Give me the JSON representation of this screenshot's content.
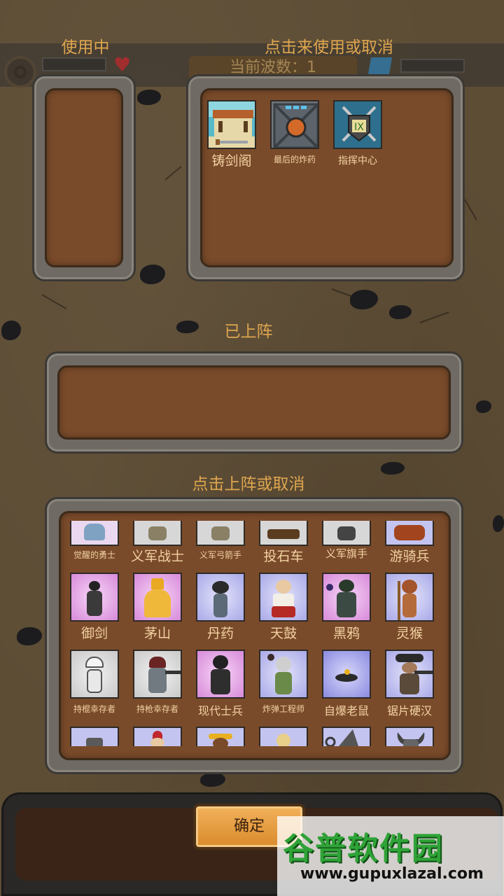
{
  "hud": {
    "wave_text": "当前波数：1"
  },
  "in_use": {
    "title": "使用中"
  },
  "toggle_use": {
    "title": "点击来使用或取消",
    "items": [
      {
        "label": "铸剑阁",
        "icon": "sword-forge-icon",
        "size": "big"
      },
      {
        "label": "最后的炸药",
        "icon": "bomb-crate-icon",
        "size": "small"
      },
      {
        "label": "指挥中心",
        "icon": "command-center-icon",
        "size": "small"
      }
    ]
  },
  "deployed": {
    "title": "已上阵"
  },
  "toggle_deploy": {
    "title": "点击上阵或取消",
    "units_row1": [
      {
        "label": "觉醒的勇士",
        "size": "small",
        "color": "#e9d8f0",
        "icon": "awakened-warrior-icon"
      },
      {
        "label": "义军战士",
        "size": "big",
        "color": "#d7d7d7",
        "icon": "rebel-warrior-icon"
      },
      {
        "label": "义军弓箭手",
        "size": "small",
        "color": "#d7d7d7",
        "icon": "rebel-archer-icon"
      },
      {
        "label": "投石车",
        "size": "big",
        "color": "#d7d7d7",
        "icon": "catapult-icon"
      },
      {
        "label": "义军旗手",
        "size": "big",
        "color": "#d7d7d7",
        "icon": "rebel-flagbearer-icon"
      },
      {
        "label": "游骑兵",
        "size": "big",
        "color": "#c4c4f0",
        "icon": "ranger-icon"
      }
    ],
    "units_row2": [
      {
        "label": "御剑",
        "size": "big",
        "color": "#e7a8e8",
        "icon": "sword-master-icon"
      },
      {
        "label": "茅山",
        "size": "big",
        "color": "#e7a8e8",
        "icon": "maoshan-taoist-icon"
      },
      {
        "label": "丹药",
        "size": "big",
        "color": "#c4c4f0",
        "icon": "alchemist-icon"
      },
      {
        "label": "天鼓",
        "size": "big",
        "color": "#c4c4f0",
        "icon": "drummer-icon"
      },
      {
        "label": "黑鸦",
        "size": "big",
        "color": "#e7a8e8",
        "icon": "black-crow-icon"
      },
      {
        "label": "灵猴",
        "size": "big",
        "color": "#c4c4f0",
        "icon": "spirit-monkey-icon"
      }
    ],
    "units_row3": [
      {
        "label": "持棍幸存者",
        "size": "small",
        "color": "#d7d7d7",
        "icon": "club-survivor-icon"
      },
      {
        "label": "持枪幸存者",
        "size": "small",
        "color": "#d7d7d7",
        "icon": "gun-survivor-icon"
      },
      {
        "label": "现代士兵",
        "size": "big",
        "color": "#e7a8e8",
        "icon": "modern-soldier-icon"
      },
      {
        "label": "炸弹工程师",
        "size": "small",
        "color": "#c4c4f0",
        "icon": "bomb-engineer-icon"
      },
      {
        "label": "自爆老鼠",
        "size": "big",
        "color": "#c4c4f0",
        "icon": "suicide-rat-icon"
      },
      {
        "label": "锯片硬汉",
        "size": "big",
        "color": "#c4c4f0",
        "icon": "sawblade-tough-guy-icon"
      }
    ],
    "units_row4": [
      {
        "icon": "helmet-unit-icon",
        "color": "#c4c4f0"
      },
      {
        "icon": "spartan-unit-icon",
        "color": "#c4c4f0"
      },
      {
        "icon": "monkey-king-unit-icon",
        "color": "#c4c4f0"
      },
      {
        "icon": "blonde-unit-icon",
        "color": "#c4c4f0"
      },
      {
        "icon": "wizard-unit-icon",
        "color": "#c4c4f0"
      },
      {
        "icon": "viking-unit-icon",
        "color": "#c4c4f0"
      }
    ]
  },
  "confirm": {
    "label": "确定"
  },
  "watermark": {
    "logo_text": "谷普软件园",
    "url": "www.gupuxlazal.com"
  }
}
